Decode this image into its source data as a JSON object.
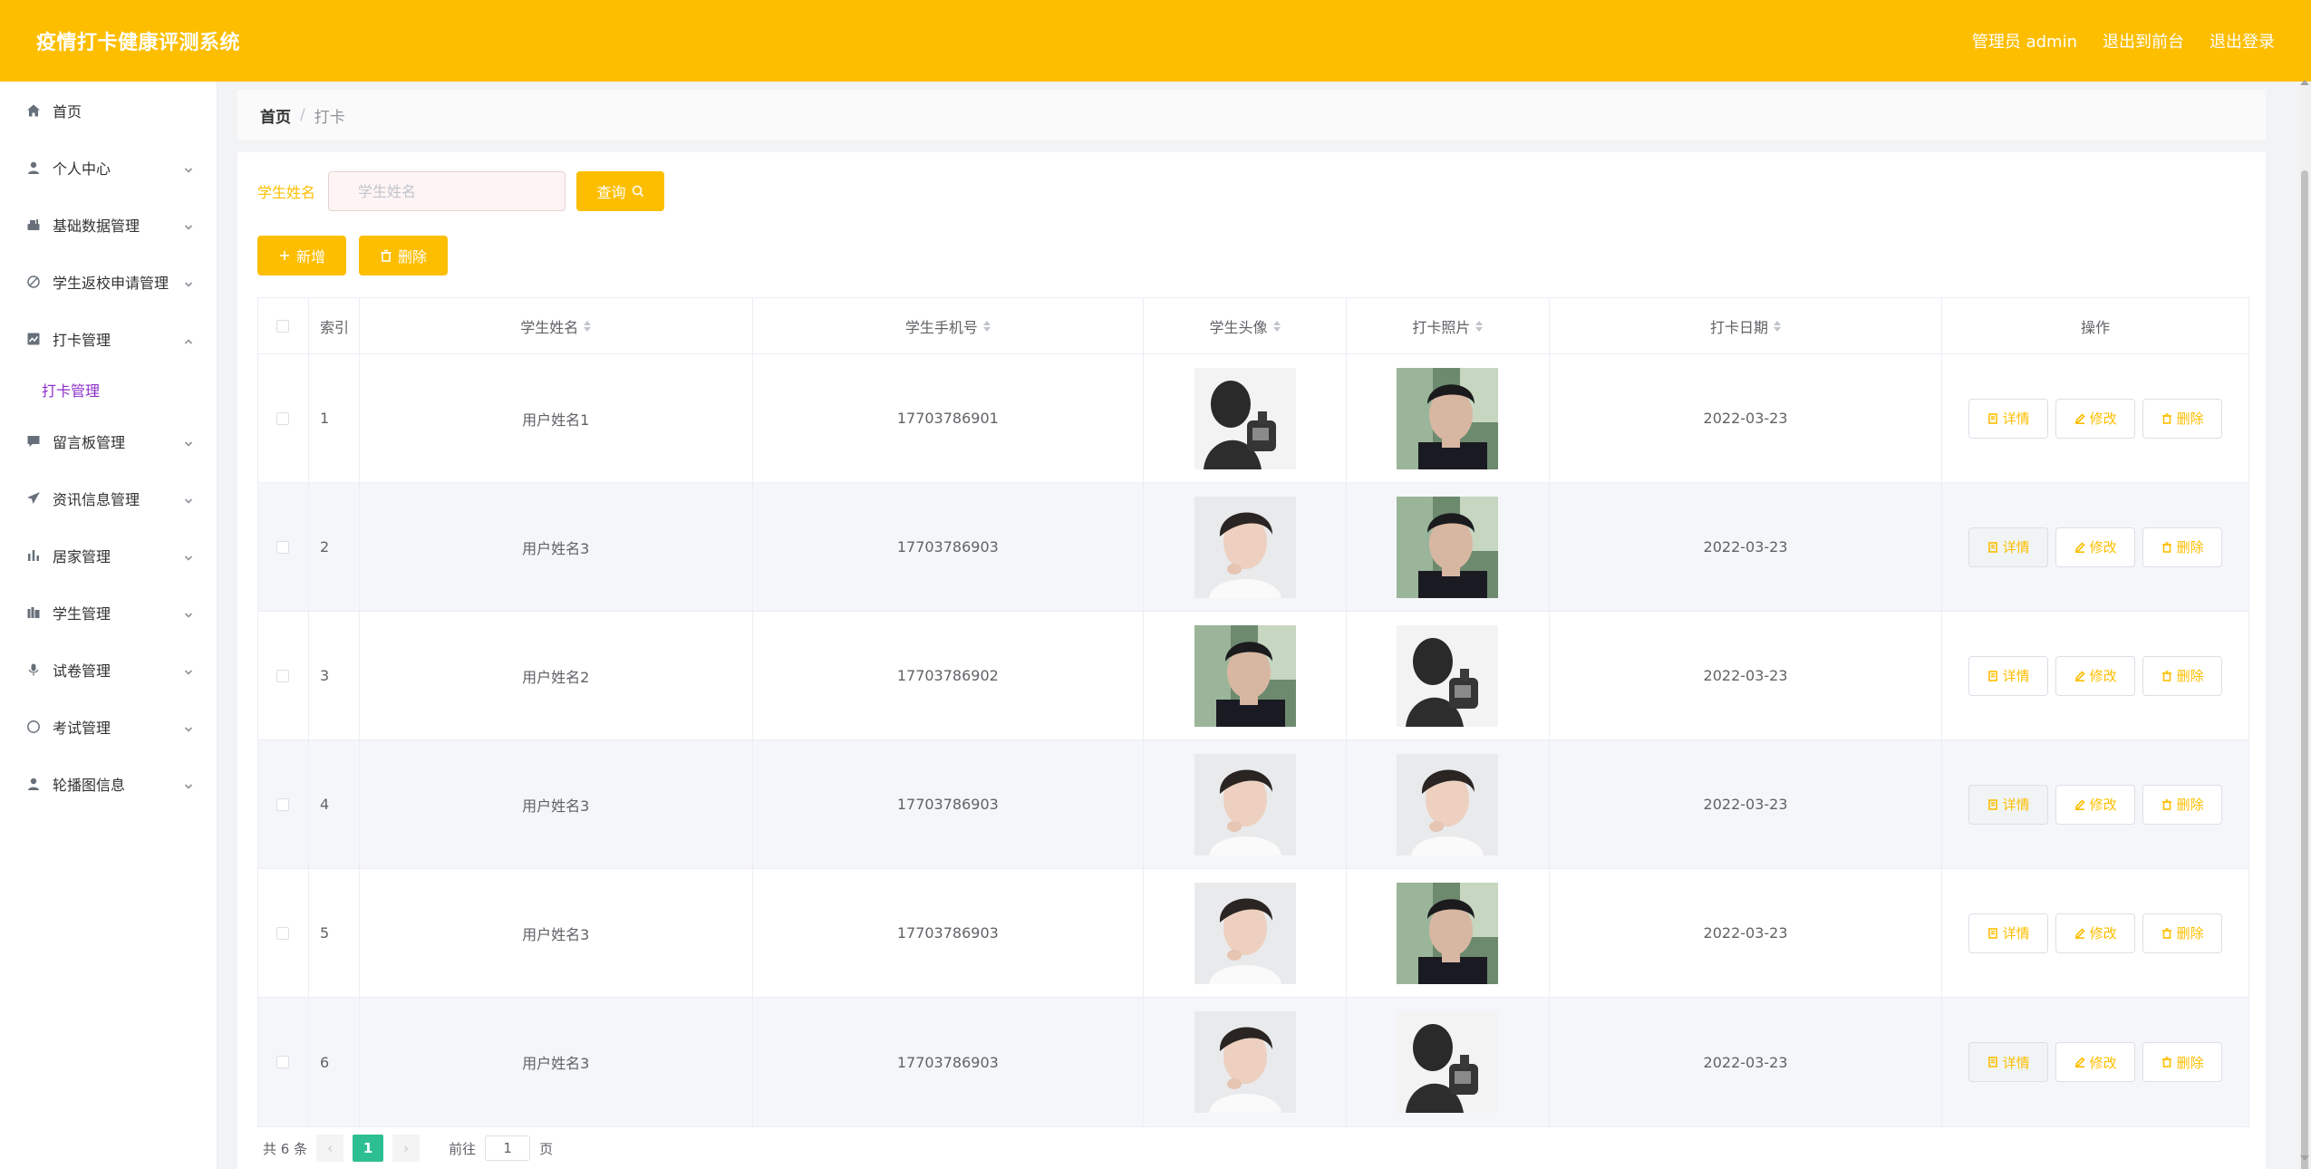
{
  "header": {
    "app_title": "疫情打卡健康评测系统",
    "admin_label": "管理员 admin",
    "to_front_label": "退出到前台",
    "logout_label": "退出登录"
  },
  "sidebar": {
    "items": [
      {
        "label": "首页",
        "icon": "home-icon",
        "expandable": false
      },
      {
        "label": "个人中心",
        "icon": "user-icon",
        "expandable": true
      },
      {
        "label": "基础数据管理",
        "icon": "data-icon",
        "expandable": true
      },
      {
        "label": "学生返校申请管理",
        "icon": "return-icon",
        "expandable": true
      },
      {
        "label": "打卡管理",
        "icon": "checkin-icon",
        "expandable": true,
        "expanded": true
      },
      {
        "label": "留言板管理",
        "icon": "message-icon",
        "expandable": true
      },
      {
        "label": "资讯信息管理",
        "icon": "send-icon",
        "expandable": true
      },
      {
        "label": "居家管理",
        "icon": "bar-chart-icon",
        "expandable": true
      },
      {
        "label": "学生管理",
        "icon": "student-icon",
        "expandable": true
      },
      {
        "label": "试卷管理",
        "icon": "mic-icon",
        "expandable": true
      },
      {
        "label": "考试管理",
        "icon": "compass-icon",
        "expandable": true
      },
      {
        "label": "轮播图信息",
        "icon": "user-icon",
        "expandable": true
      }
    ],
    "submenu_active": "打卡管理"
  },
  "breadcrumb": {
    "home": "首页",
    "separator": "/",
    "current": "打卡"
  },
  "search": {
    "label": "学生姓名",
    "placeholder": "学生姓名",
    "value": "",
    "button_label": "查询"
  },
  "actions": {
    "add_label": "新增",
    "delete_label": "删除"
  },
  "table": {
    "columns": [
      "索引",
      "学生姓名",
      "学生手机号",
      "学生头像",
      "打卡照片",
      "打卡日期",
      "操作"
    ],
    "rows": [
      {
        "index": "1",
        "name": "用户姓名1",
        "phone": "17703786901",
        "avatar": "photo-b",
        "photo": "photo-a",
        "date": "2022-03-23"
      },
      {
        "index": "2",
        "name": "用户姓名3",
        "phone": "17703786903",
        "avatar": "photo-c",
        "photo": "photo-a",
        "date": "2022-03-23"
      },
      {
        "index": "3",
        "name": "用户姓名2",
        "phone": "17703786902",
        "avatar": "photo-a",
        "photo": "photo-b",
        "date": "2022-03-23"
      },
      {
        "index": "4",
        "name": "用户姓名3",
        "phone": "17703786903",
        "avatar": "photo-c",
        "photo": "photo-c",
        "date": "2022-03-23"
      },
      {
        "index": "5",
        "name": "用户姓名3",
        "phone": "17703786903",
        "avatar": "photo-c",
        "photo": "photo-a",
        "date": "2022-03-23"
      },
      {
        "index": "6",
        "name": "用户姓名3",
        "phone": "17703786903",
        "avatar": "photo-c",
        "photo": "photo-b",
        "date": "2022-03-23"
      }
    ],
    "op_labels": {
      "detail": "详情",
      "edit": "修改",
      "delete": "删除"
    }
  },
  "pagination": {
    "total_text": "共 6 条",
    "current_page": "1",
    "goto_prefix": "前往",
    "goto_value": "1",
    "goto_suffix": "页"
  },
  "colors": {
    "brand": "#fdbe00",
    "pager_active": "#2ebf91",
    "submenu_active": "#8b2fc9"
  }
}
